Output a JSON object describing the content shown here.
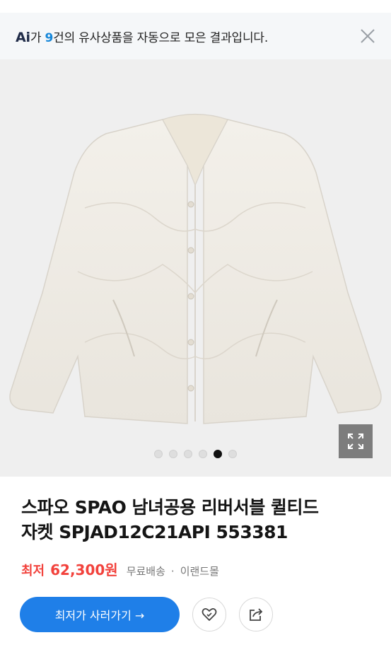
{
  "banner": {
    "logo": "Ai",
    "prefix": "가 ",
    "count": "9",
    "suffix": "건의 유사상품을 자동으로 모은 결과입니다."
  },
  "carousel": {
    "slides": 6,
    "active_index": 4
  },
  "product": {
    "title_line1": "스파오 SPAO 남녀공용 리버서블 퀼티드",
    "title_line2": "자켓 SPJAD12C21API 553381",
    "price_label": "최저",
    "price": "62,300원",
    "shipping": "무료배송",
    "separator": "·",
    "seller": "이랜드몰"
  },
  "actions": {
    "buy_label": "최저가 사러가기 →"
  },
  "colors": {
    "accent": "#1f7fe8",
    "price": "#f2423c",
    "ai_count": "#1687d9"
  },
  "icons": [
    "close-icon",
    "expand-icon",
    "heart-icon",
    "share-icon"
  ]
}
